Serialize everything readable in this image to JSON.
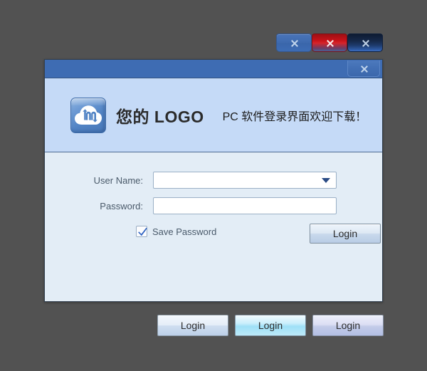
{
  "window": {
    "background_color": "#525252"
  },
  "close_button_samples": [
    {
      "name": "close-sample-normal",
      "glyph": "×",
      "state": "normal",
      "color": "#3f6bb0"
    },
    {
      "name": "close-sample-hover",
      "glyph": "×",
      "state": "hover",
      "color": "#c8131a"
    },
    {
      "name": "close-sample-pressed",
      "glyph": "×",
      "state": "pressed",
      "color": "#16294a"
    }
  ],
  "dialog": {
    "titlebar": {
      "title": "",
      "close_label": "×",
      "background_color": "#3e6cb3"
    },
    "header": {
      "background_color": "#c5daf7",
      "logo_icon": "cloud-download-logo-icon",
      "logo_text": "您的 LOGO",
      "tagline": "PC 软件登录界面欢迎下载！"
    },
    "form": {
      "username": {
        "label": "User Name:",
        "value": "",
        "placeholder": "",
        "dropdown_icon": "chevron-down-icon"
      },
      "password": {
        "label": "Password:",
        "value": "",
        "placeholder": ""
      },
      "save_password": {
        "label": "Save Password",
        "checked": true,
        "check_icon": "checkmark-icon"
      },
      "login_button": {
        "label": "Login"
      }
    }
  },
  "bottom_buttons": [
    {
      "label": "Login",
      "state": "normal"
    },
    {
      "label": "Login",
      "state": "hover"
    },
    {
      "label": "Login",
      "state": "pressed"
    }
  ]
}
